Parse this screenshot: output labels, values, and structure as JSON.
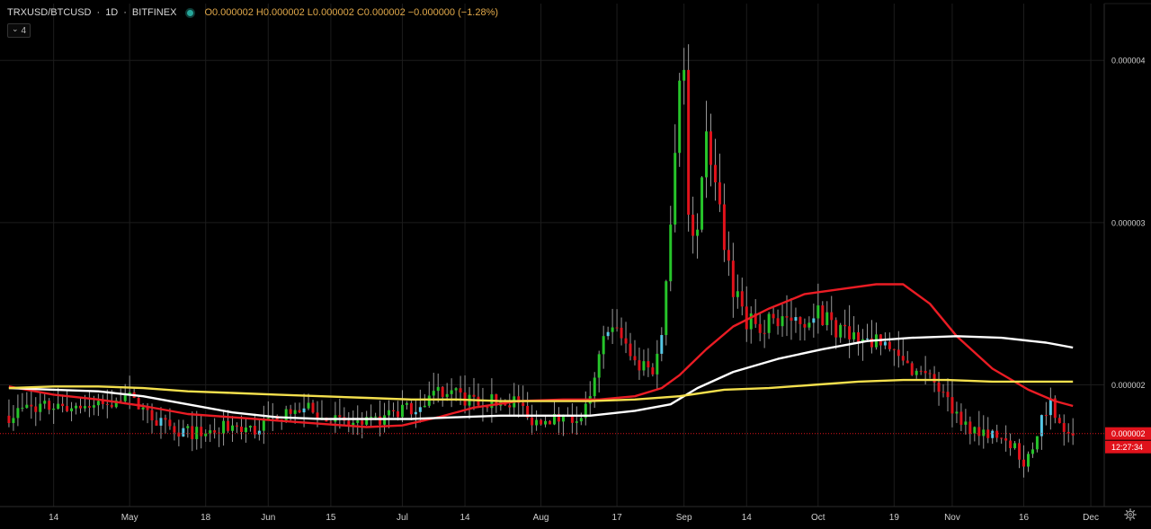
{
  "header": {
    "symbol": "TRXUSD/BTCUSD",
    "sep1": "·",
    "interval": "1D",
    "sep2": "·",
    "exchange": "BITFINEX",
    "ohlc": "O0.000002 H0.000002 L0.000002 C0.000002 −0.000000 (−1.28%)"
  },
  "indicator_toggle": {
    "chevron": "⌄",
    "count": "4"
  },
  "colors": {
    "background": "#000000",
    "grid": "#1c1c1c",
    "up": "#26c42a",
    "down": "#e0121b",
    "up_hollow": "#56c8e6",
    "ma_red": "#ea1c24",
    "ma_white": "#ffffff",
    "ma_yellow": "#f4e04d",
    "axis_text": "#cfcfcf",
    "price_label_bg": "#e0121b"
  },
  "price_axis": {
    "ticks": [
      {
        "value": 4e-06,
        "label": "0.000004"
      },
      {
        "value": 3e-06,
        "label": "0.000003"
      },
      {
        "value": 2e-06,
        "label": "0.000002"
      }
    ],
    "current_price_label": "0.000002",
    "countdown_label": "12:27:34"
  },
  "chart_data": {
    "type": "candlestick",
    "title": "TRXUSD/BTCUSD · 1D · BITFINEX",
    "ylim": [
      1.25e-06,
      4.35e-06
    ],
    "x_range_days": [
      0,
      214
    ],
    "grid": true,
    "x_ticks": [
      {
        "day": 10,
        "label": "14"
      },
      {
        "day": 27,
        "label": "May"
      },
      {
        "day": 44,
        "label": "18"
      },
      {
        "day": 58,
        "label": "Jun"
      },
      {
        "day": 72,
        "label": "15"
      },
      {
        "day": 88,
        "label": "Jul"
      },
      {
        "day": 102,
        "label": "14"
      },
      {
        "day": 119,
        "label": "Aug"
      },
      {
        "day": 136,
        "label": "17"
      },
      {
        "day": 151,
        "label": "Sep"
      },
      {
        "day": 165,
        "label": "14"
      },
      {
        "day": 181,
        "label": "Oct"
      },
      {
        "day": 198,
        "label": "19"
      },
      {
        "day": 211,
        "label": "Nov"
      },
      {
        "day": 227,
        "label": "16"
      },
      {
        "day": 242,
        "label": "Dec"
      }
    ],
    "current_price": 1.7e-06,
    "keyframes": [
      [
        0,
        1.81e-06
      ],
      [
        5,
        1.87e-06
      ],
      [
        10,
        1.86e-06
      ],
      [
        15,
        1.87e-06
      ],
      [
        20,
        1.86e-06
      ],
      [
        26,
        1.94e-06
      ],
      [
        30,
        1.85e-06
      ],
      [
        34,
        1.76e-06
      ],
      [
        38,
        1.72e-06
      ],
      [
        42,
        1.7e-06
      ],
      [
        46,
        1.72e-06
      ],
      [
        50,
        1.75e-06
      ],
      [
        55,
        1.72e-06
      ],
      [
        60,
        1.82e-06
      ],
      [
        64,
        1.8e-06
      ],
      [
        66,
        1.88e-06
      ],
      [
        68,
        1.82e-06
      ],
      [
        72,
        1.78e-06
      ],
      [
        76,
        1.76e-06
      ],
      [
        80,
        1.76e-06
      ],
      [
        84,
        1.8e-06
      ],
      [
        88,
        1.84e-06
      ],
      [
        92,
        1.89e-06
      ],
      [
        96,
        1.96e-06
      ],
      [
        98,
        1.97e-06
      ],
      [
        102,
        1.91e-06
      ],
      [
        106,
        1.9e-06
      ],
      [
        110,
        1.9e-06
      ],
      [
        114,
        1.9e-06
      ],
      [
        116,
        1.79e-06
      ],
      [
        120,
        1.79e-06
      ],
      [
        124,
        1.79e-06
      ],
      [
        128,
        1.8e-06
      ],
      [
        130,
        1.9e-06
      ],
      [
        132,
        2.15e-06
      ],
      [
        134,
        2.38e-06
      ],
      [
        136,
        2.31e-06
      ],
      [
        138,
        2.25e-06
      ],
      [
        140,
        2.13e-06
      ],
      [
        142,
        2.1e-06
      ],
      [
        144,
        2.1e-06
      ],
      [
        146,
        2.32e-06
      ],
      [
        148,
        3.05e-06
      ],
      [
        150,
        3.95e-06
      ],
      [
        151,
        3.92e-06
      ],
      [
        152,
        3.05e-06
      ],
      [
        154,
        2.9e-06
      ],
      [
        156,
        3.5e-06
      ],
      [
        158,
        3.3e-06
      ],
      [
        160,
        2.9e-06
      ],
      [
        162,
        2.6e-06
      ],
      [
        165,
        2.4e-06
      ],
      [
        168,
        2.35e-06
      ],
      [
        171,
        2.42e-06
      ],
      [
        174,
        2.4e-06
      ],
      [
        178,
        2.4e-06
      ],
      [
        181,
        2.45e-06
      ],
      [
        184,
        2.36e-06
      ],
      [
        188,
        2.32e-06
      ],
      [
        192,
        2.28e-06
      ],
      [
        196,
        2.23e-06
      ],
      [
        200,
        2.13e-06
      ],
      [
        204,
        2.07e-06
      ],
      [
        207,
        2.01e-06
      ],
      [
        210,
        1.88e-06
      ],
      [
        214,
        1.75e-06
      ],
      [
        218,
        1.72e-06
      ],
      [
        222,
        1.68e-06
      ],
      [
        225,
        1.63e-06
      ],
      [
        227,
        1.52e-06
      ],
      [
        229,
        1.62e-06
      ],
      [
        231,
        1.8e-06
      ],
      [
        233,
        1.9e-06
      ],
      [
        234,
        1.82e-06
      ],
      [
        236,
        1.74e-06
      ],
      [
        238,
        1.72e-06
      ]
    ],
    "series": [
      {
        "name": "",
        "color": "#ea1c24",
        "points": [
          [
            0,
            1.99e-06
          ],
          [
            10,
            1.94e-06
          ],
          [
            20,
            1.91e-06
          ],
          [
            30,
            1.87e-06
          ],
          [
            40,
            1.82e-06
          ],
          [
            50,
            1.8e-06
          ],
          [
            60,
            1.78e-06
          ],
          [
            70,
            1.76e-06
          ],
          [
            80,
            1.74e-06
          ],
          [
            88,
            1.75e-06
          ],
          [
            96,
            1.8e-06
          ],
          [
            104,
            1.86e-06
          ],
          [
            114,
            1.9e-06
          ],
          [
            124,
            1.91e-06
          ],
          [
            132,
            1.91e-06
          ],
          [
            140,
            1.93e-06
          ],
          [
            146,
            1.98e-06
          ],
          [
            150,
            2.06e-06
          ],
          [
            156,
            2.22e-06
          ],
          [
            162,
            2.36e-06
          ],
          [
            170,
            2.47e-06
          ],
          [
            178,
            2.56e-06
          ],
          [
            186,
            2.59e-06
          ],
          [
            194,
            2.62e-06
          ],
          [
            200,
            2.62e-06
          ],
          [
            206,
            2.5e-06
          ],
          [
            212,
            2.3e-06
          ],
          [
            220,
            2.1e-06
          ],
          [
            228,
            1.97e-06
          ],
          [
            234,
            1.9e-06
          ],
          [
            238,
            1.87e-06
          ]
        ]
      },
      {
        "name": "",
        "color": "#ffffff",
        "points": [
          [
            0,
            1.98e-06
          ],
          [
            10,
            1.97e-06
          ],
          [
            20,
            1.96e-06
          ],
          [
            30,
            1.93e-06
          ],
          [
            40,
            1.88e-06
          ],
          [
            50,
            1.83e-06
          ],
          [
            60,
            1.8e-06
          ],
          [
            70,
            1.79e-06
          ],
          [
            80,
            1.79e-06
          ],
          [
            90,
            1.79e-06
          ],
          [
            100,
            1.8e-06
          ],
          [
            110,
            1.81e-06
          ],
          [
            120,
            1.81e-06
          ],
          [
            130,
            1.81e-06
          ],
          [
            140,
            1.84e-06
          ],
          [
            148,
            1.88e-06
          ],
          [
            154,
            1.98e-06
          ],
          [
            162,
            2.08e-06
          ],
          [
            172,
            2.16e-06
          ],
          [
            182,
            2.22e-06
          ],
          [
            192,
            2.27e-06
          ],
          [
            202,
            2.29e-06
          ],
          [
            212,
            2.3e-06
          ],
          [
            222,
            2.29e-06
          ],
          [
            232,
            2.26e-06
          ],
          [
            238,
            2.23e-06
          ]
        ]
      },
      {
        "name": "",
        "color": "#f4e04d",
        "points": [
          [
            0,
            1.98e-06
          ],
          [
            10,
            1.99e-06
          ],
          [
            20,
            1.99e-06
          ],
          [
            30,
            1.98e-06
          ],
          [
            40,
            1.96e-06
          ],
          [
            50,
            1.95e-06
          ],
          [
            60,
            1.94e-06
          ],
          [
            70,
            1.93e-06
          ],
          [
            80,
            1.92e-06
          ],
          [
            90,
            1.91e-06
          ],
          [
            100,
            1.91e-06
          ],
          [
            110,
            1.9e-06
          ],
          [
            120,
            1.9e-06
          ],
          [
            130,
            1.9e-06
          ],
          [
            140,
            1.91e-06
          ],
          [
            150,
            1.93e-06
          ],
          [
            160,
            1.97e-06
          ],
          [
            170,
            1.98e-06
          ],
          [
            180,
            2e-06
          ],
          [
            190,
            2.02e-06
          ],
          [
            200,
            2.03e-06
          ],
          [
            210,
            2.03e-06
          ],
          [
            220,
            2.02e-06
          ],
          [
            230,
            2.02e-06
          ],
          [
            238,
            2.02e-06
          ]
        ]
      }
    ]
  }
}
